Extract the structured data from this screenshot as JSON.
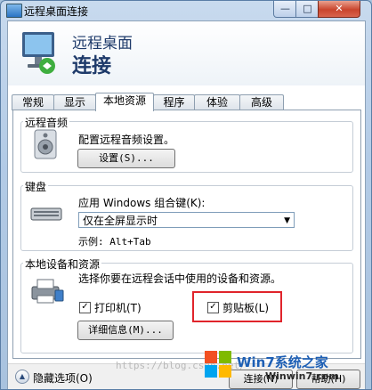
{
  "window": {
    "title": "远程桌面连接",
    "min": "—",
    "max": "□",
    "close": "✕"
  },
  "banner": {
    "line1": "远程桌面",
    "line2": "连接"
  },
  "tabs": [
    {
      "label": "常规"
    },
    {
      "label": "显示"
    },
    {
      "label": "本地资源"
    },
    {
      "label": "程序"
    },
    {
      "label": "体验"
    },
    {
      "label": "高级"
    }
  ],
  "remote_audio": {
    "title": "远程音频",
    "desc": "配置远程音频设置。",
    "settings_button": "设置(S)..."
  },
  "keyboard": {
    "title": "键盘",
    "desc": "应用 Windows 组合键(K):",
    "selected": "仅在全屏显示时",
    "example": "示例: Alt+Tab"
  },
  "local_devices": {
    "title": "本地设备和资源",
    "desc": "选择你要在远程会话中使用的设备和资源。",
    "printers": {
      "label": "打印机(T)",
      "checked": true,
      "mark": "✓"
    },
    "clipboard": {
      "label": "剪贴板(L)",
      "checked": true,
      "mark": "✓"
    },
    "more_button": "详细信息(M)..."
  },
  "footer": {
    "hide_options": "隐藏选项(O)",
    "connect": "连接(N)",
    "help": "帮助(H)"
  },
  "watermark": {
    "url": "https://blog.csdn.net/",
    "brand": "Win7系统之家",
    "site": "Winwin7.com"
  },
  "colors": {
    "highlight": "#e0242b",
    "accent": "#1e3a6a"
  }
}
